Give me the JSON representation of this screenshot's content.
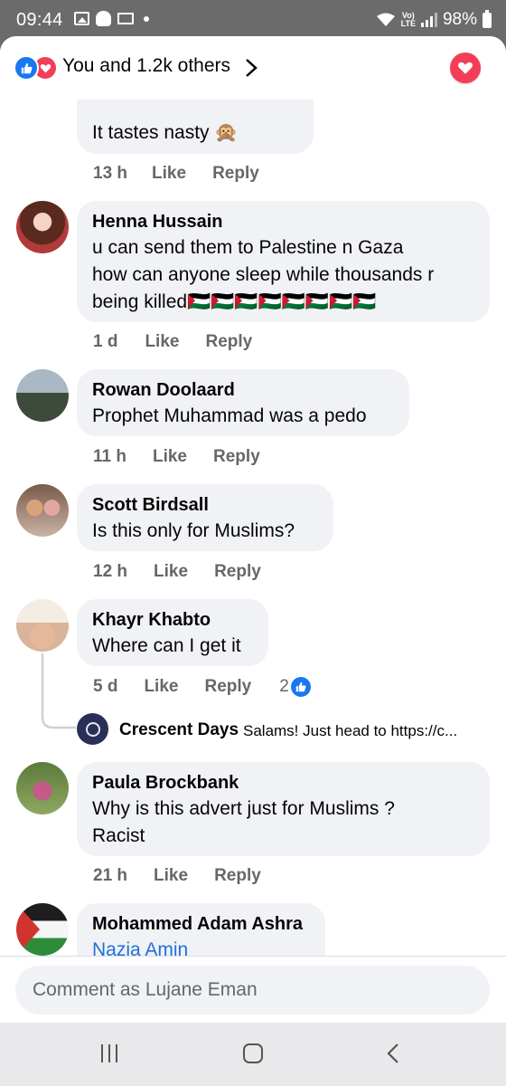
{
  "status_bar": {
    "time": "09:44",
    "lte": "Vo) LTE",
    "battery": "98%"
  },
  "header": {
    "reactions_summary": "You and 1.2k others"
  },
  "comments": [
    {
      "text": "It tastes nasty 🙊",
      "time": "13 h",
      "like": "Like",
      "reply": "Reply"
    },
    {
      "author": "Henna Hussain",
      "lines": [
        "u can send them to Palestine n Gaza",
        "how can anyone sleep while thousands r",
        "being killed🇵🇸🇵🇸🇵🇸🇵🇸🇵🇸🇵🇸🇵🇸🇵🇸"
      ],
      "time": "1 d",
      "like": "Like",
      "reply": "Reply"
    },
    {
      "author": "Rowan Doolaard",
      "lines": [
        "Prophet Muhammad was a pedo"
      ],
      "time": "11 h",
      "like": "Like",
      "reply": "Reply"
    },
    {
      "author": "Scott Birdsall",
      "lines": [
        "Is this only for Muslims?"
      ],
      "time": "12 h",
      "like": "Like",
      "reply": "Reply"
    },
    {
      "author": "Khayr Khabto",
      "lines": [
        "Where can I get it"
      ],
      "time": "5 d",
      "like": "Like",
      "reply": "Reply",
      "reaction_count": "2",
      "reply_preview": {
        "author": "Crescent Days",
        "text": "Salams! Just head to https://c..."
      }
    },
    {
      "author": "Paula Brockbank",
      "lines": [
        "Why is this advert just for Muslims ?",
        "Racist"
      ],
      "time": "21 h",
      "like": "Like",
      "reply": "Reply"
    },
    {
      "author": "Mohammed Adam Ashra",
      "lines": [
        "Nazia Amin"
      ]
    }
  ],
  "composer": {
    "placeholder": "Comment as Lujane Eman"
  },
  "colors": {
    "link": "#216fdb",
    "like_blue": "#1877f2",
    "love_red": "#f33e58",
    "bubble": "#f0f2f5",
    "meta_gray": "#65676b"
  }
}
